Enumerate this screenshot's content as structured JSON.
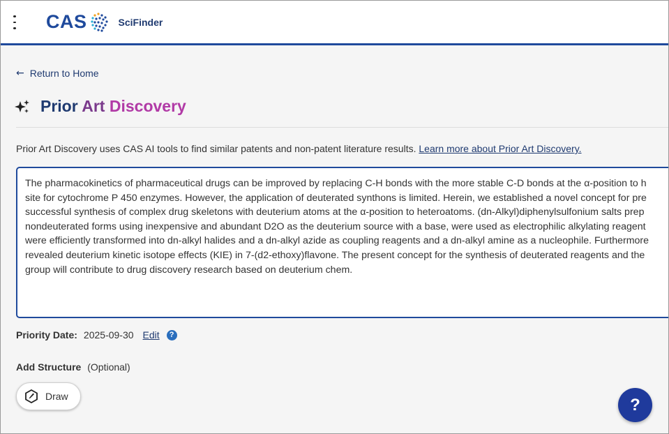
{
  "header": {
    "logo_text": "CAS",
    "product_name": "SciFinder",
    "menu_icon": "more-vertical-icon",
    "brand_color": "#1f4a9c"
  },
  "nav": {
    "back_label": "Return to Home",
    "back_icon": "arrow-left-icon"
  },
  "page": {
    "title_part1": "Prior",
    "title_part2": "Art",
    "title_part3": "Discovery",
    "title_icon": "sparkle-icon",
    "intro_text": "Prior Art Discovery uses CAS AI tools to find similar patents and non-patent literature results.",
    "intro_link": "Learn more about Prior Art Discovery."
  },
  "query": {
    "lines": [
      " The pharmacokinetics of pharmaceutical drugs can be improved by replacing C-H bonds with the more stable C-D bonds at the α-position to h",
      "site for cytochrome P 450 enzymes. However, the application of deuterated synthons is limited. Herein, we established a novel concept for pre",
      "successful synthesis of complex drug skeletons with deuterium atoms at the α-position to heteroatoms. (dn-Alkyl)diphenylsulfonium salts prep",
      "nondeuterated forms using inexpensive and abundant D2O as the deuterium source with a base, were used as electrophilic alkylating reagent",
      "were efficiently transformed into dn-alkyl halides and a dn-alkyl azide as coupling reagents and a dn-alkyl amine as a nucleophile. Furthermore",
      "revealed deuterium kinetic isotope effects (KIE) in 7-(d2-ethoxy)flavone. The present concept for the synthesis of deuterated reagents and the",
      "group will contribute to drug discovery research based on deuterium chem."
    ]
  },
  "priority": {
    "label": "Priority Date:",
    "value": "2025-09-30",
    "edit_label": "Edit",
    "help_glyph": "?"
  },
  "structure": {
    "label": "Add Structure",
    "optional_label": "(Optional)",
    "draw_label": "Draw",
    "draw_icon": "draw-structure-icon"
  },
  "help_fab": {
    "glyph": "?"
  }
}
